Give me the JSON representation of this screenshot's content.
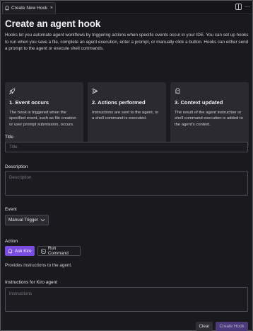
{
  "tab": {
    "title": "Create New Hook",
    "close": "×"
  },
  "titlebar": {
    "more": "···"
  },
  "page": {
    "title": "Create an agent hook",
    "intro": "Hooks let you automate agent workflows by triggering actions when specific events occur in your IDE. You can set up hooks to run when you save a file, complete an agent execution, enter a prompt, or manually click a button. Hooks can either send a prompt to the agent or execute shell commands."
  },
  "cards": [
    {
      "icon": "rocket-icon",
      "title": "1. Event occurs",
      "text": "The hook is triggered when the specified event, such as file creation or user prompt submission, occurs."
    },
    {
      "icon": "send-icon",
      "title": "2. Actions performed",
      "text": "Instructions are sent to the agent, or a shell command is executed."
    },
    {
      "icon": "kiro-ghost-icon",
      "title": "3. Context updated",
      "text": "The result of the agent instruction or shell command execution is added to the agent's context."
    }
  ],
  "form": {
    "title": {
      "label": "Title",
      "placeholder": "Title",
      "value": ""
    },
    "description": {
      "label": "Description",
      "placeholder": "Description",
      "value": ""
    },
    "event": {
      "label": "Event",
      "selected": "Manual Trigger"
    },
    "action": {
      "label": "Action",
      "options": [
        "Ask Kiro",
        "Run Command"
      ],
      "selected": "Ask Kiro",
      "hint": "Provides instructions to the agent."
    },
    "instructions": {
      "label": "Instructions for Kiro agent",
      "placeholder": "Instructions",
      "value": ""
    }
  },
  "footer": {
    "clear": "Clear",
    "create": "Create Hook"
  },
  "colors": {
    "accent": "#7a4ce0",
    "background": "#1a1a1e",
    "card": "#2a2a30",
    "create_disabled": "#4a3a7a"
  }
}
